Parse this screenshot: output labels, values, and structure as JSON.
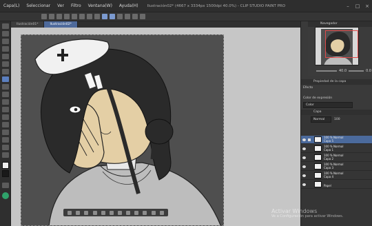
{
  "menu": {
    "items": [
      "Capa(L)",
      "Seleccionar",
      "Ver",
      "Filtro",
      "Ventana(W)",
      "Ayuda(H)"
    ],
    "window_title": "Ilustración02* (4667 x 3334px 1500dpi 40.0%) - CLIP STUDIO PAINT PRO"
  },
  "tabs": [
    {
      "label": "Ilustración01*"
    },
    {
      "label": "Ilustración02*"
    }
  ],
  "navigator": {
    "title": "Navegador",
    "zoom": "40.0",
    "angle": "0.0"
  },
  "panels": {
    "layer_property_title": "Propiedad de la capa",
    "effect_label": "Efecto",
    "color_expression_label": "Color de expresión",
    "color_expression_value": "Color",
    "layer_tab": "Capa",
    "blend_mode": "Normal",
    "opacity": "100"
  },
  "layers": [
    {
      "line1": "100 % Normal",
      "line2": "Capa 5",
      "selected": true
    },
    {
      "line1": "100 % Normal",
      "line2": "Capa 1",
      "selected": false
    },
    {
      "line1": "100 % Normal",
      "line2": "Capa 2",
      "selected": false
    },
    {
      "line1": "100 % Normal",
      "line2": "Capa 3",
      "selected": false
    },
    {
      "line1": "100 % Normal",
      "line2": "Capa 4",
      "selected": false
    },
    {
      "line1": "",
      "line2": "Papel",
      "selected": false
    }
  ],
  "watermark": {
    "line1": "Activar Windows",
    "line2": "Ve a Configuración para activar Windows."
  },
  "colors": {
    "accent": "#4b6a9c",
    "main_color": "#f0f0f0",
    "sub_color": "#1a1a1a"
  }
}
